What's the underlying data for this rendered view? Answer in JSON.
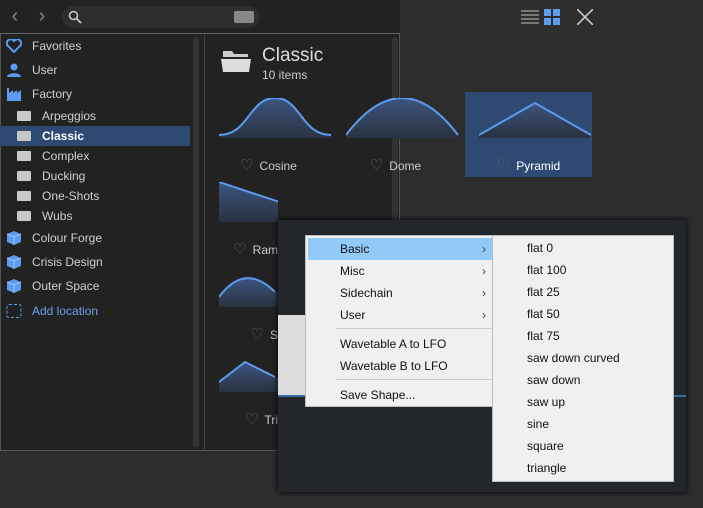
{
  "toolbar": {
    "back_icon": "chevron-left",
    "forward_icon": "chevron-right",
    "search_placeholder": "",
    "keyboard_icon": "keyboard",
    "list_view_icon": "list",
    "grid_view_icon": "grid",
    "close_icon": "close"
  },
  "sidebar": {
    "items": [
      {
        "label": "Favorites",
        "icon": "heart",
        "type": "top"
      },
      {
        "label": "User",
        "icon": "user",
        "type": "top"
      },
      {
        "label": "Factory",
        "icon": "factory",
        "type": "top"
      },
      {
        "label": "Arpeggios",
        "icon": "folder",
        "type": "sub"
      },
      {
        "label": "Classic",
        "icon": "folder-open",
        "type": "sub",
        "selected": true
      },
      {
        "label": "Complex",
        "icon": "folder",
        "type": "sub"
      },
      {
        "label": "Ducking",
        "icon": "folder",
        "type": "sub"
      },
      {
        "label": "One-Shots",
        "icon": "folder",
        "type": "sub"
      },
      {
        "label": "Wubs",
        "icon": "folder",
        "type": "sub"
      },
      {
        "label": "Colour Forge",
        "icon": "package",
        "type": "top"
      },
      {
        "label": "Crisis Design",
        "icon": "package",
        "type": "top"
      },
      {
        "label": "Outer Space",
        "icon": "package",
        "type": "top"
      },
      {
        "label": "Add location",
        "icon": "dashed-square",
        "type": "add"
      }
    ]
  },
  "main": {
    "title": "Classic",
    "count": "10 items",
    "thumbs": [
      {
        "label": "Cosine"
      },
      {
        "label": "Dome"
      },
      {
        "label": "Pyramid",
        "selected": true
      },
      {
        "label": "Ram"
      },
      {
        "label": "S"
      },
      {
        "label": "Tri"
      }
    ]
  },
  "menu": {
    "items": [
      {
        "label": "Basic",
        "submenu": true,
        "highlighted": true
      },
      {
        "label": "Misc",
        "submenu": true
      },
      {
        "label": "Sidechain",
        "submenu": true
      },
      {
        "label": "User",
        "submenu": true
      },
      {
        "label": "Wavetable A to LFO"
      },
      {
        "label": "Wavetable B to LFO"
      },
      {
        "label": "Save Shape..."
      }
    ]
  },
  "submenu": {
    "items": [
      "flat 0",
      "flat 100",
      "flat 25",
      "flat 50",
      "flat 75",
      "saw down curved",
      "saw down",
      "saw up",
      "sine",
      "square",
      "triangle"
    ]
  },
  "colors": {
    "accent": "#5b9cf0",
    "selection": "#2e4a73",
    "menu_highlight": "#91c9f7"
  }
}
